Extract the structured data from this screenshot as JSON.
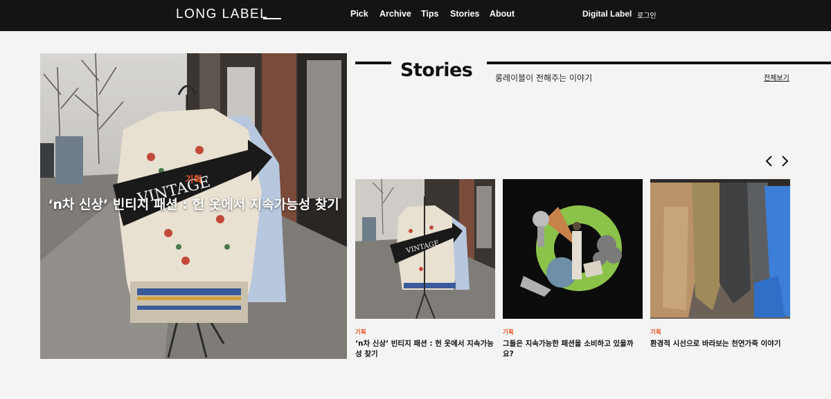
{
  "header": {
    "logo": "LONG LABEL",
    "nav": [
      "Pick",
      "Archive",
      "Tips",
      "Stories",
      "About"
    ],
    "digital_label": "Digital Label",
    "login": "로그인"
  },
  "hero": {
    "category": "기획",
    "title": "‘n차 신상’ 빈티지 패션 : 헌 옷에서 지속가능성 찾기",
    "sign_text": "VINTAGE"
  },
  "stories": {
    "title": "Stories",
    "subtitle": "롱레이블이 전해주는 이야기",
    "view_all": "전체보기",
    "cards": [
      {
        "category": "기획",
        "title": "‘n차 신상’ 빈티지 패션 : 헌 옷에서 지속가능성 찾기",
        "sign_text": "VINTAGE"
      },
      {
        "category": "기획",
        "title": "그들은 지속가능한 패션을 소비하고 있을까요?"
      },
      {
        "category": "기획",
        "title": "환경적 시선으로 바라보는 천연가죽 이야기"
      }
    ]
  },
  "colors": {
    "header_bg": "#141414",
    "page_bg": "#f4f4f4",
    "accent": "#e8562b"
  }
}
